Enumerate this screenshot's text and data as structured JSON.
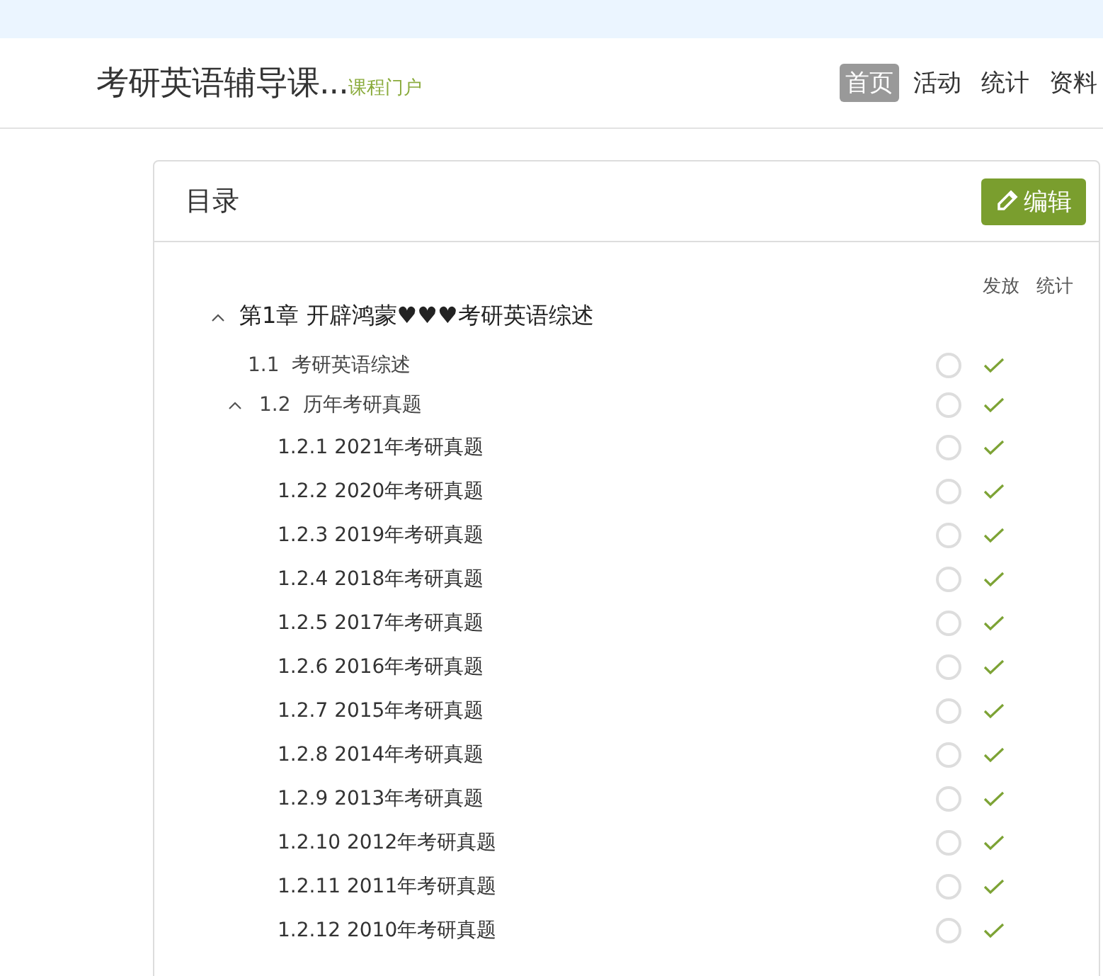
{
  "header": {
    "title": "考研英语辅导课...",
    "subtitle": "课程门户",
    "nav": [
      {
        "label": "首页",
        "selected": true
      },
      {
        "label": "活动",
        "selected": false
      },
      {
        "label": "统计",
        "selected": false
      },
      {
        "label": "资料",
        "selected": false
      }
    ]
  },
  "card": {
    "title": "目录",
    "edit_button": "编辑",
    "columns": [
      "发放",
      "统计"
    ],
    "chapters": [
      {
        "title": "第1章 开辟鸿蒙♥♥♥考研英语综述",
        "expanded": true,
        "children": [
          {
            "number": "1.1",
            "title": "考研英语综述",
            "released": false,
            "stats": true
          },
          {
            "number": "1.2",
            "title": "历年考研真题",
            "released": false,
            "stats": true,
            "expanded": true,
            "children": [
              {
                "number": "1.2.1",
                "title": "2021年考研真题",
                "released": false,
                "stats": true
              },
              {
                "number": "1.2.2",
                "title": "2020年考研真题",
                "released": false,
                "stats": true
              },
              {
                "number": "1.2.3",
                "title": "2019年考研真题",
                "released": false,
                "stats": true
              },
              {
                "number": "1.2.4",
                "title": "2018年考研真题",
                "released": false,
                "stats": true
              },
              {
                "number": "1.2.5",
                "title": "2017年考研真题",
                "released": false,
                "stats": true
              },
              {
                "number": "1.2.6",
                "title": "2016年考研真题",
                "released": false,
                "stats": true
              },
              {
                "number": "1.2.7",
                "title": "2015年考研真题",
                "released": false,
                "stats": true
              },
              {
                "number": "1.2.8",
                "title": "2014年考研真题",
                "released": false,
                "stats": true
              },
              {
                "number": "1.2.9",
                "title": "2013年考研真题",
                "released": false,
                "stats": true
              },
              {
                "number": "1.2.10",
                "title": "2012年考研真题",
                "released": false,
                "stats": true
              },
              {
                "number": "1.2.11",
                "title": "2011年考研真题",
                "released": false,
                "stats": true
              },
              {
                "number": "1.2.12",
                "title": "2010年考研真题",
                "released": false,
                "stats": true
              }
            ]
          }
        ]
      }
    ]
  }
}
